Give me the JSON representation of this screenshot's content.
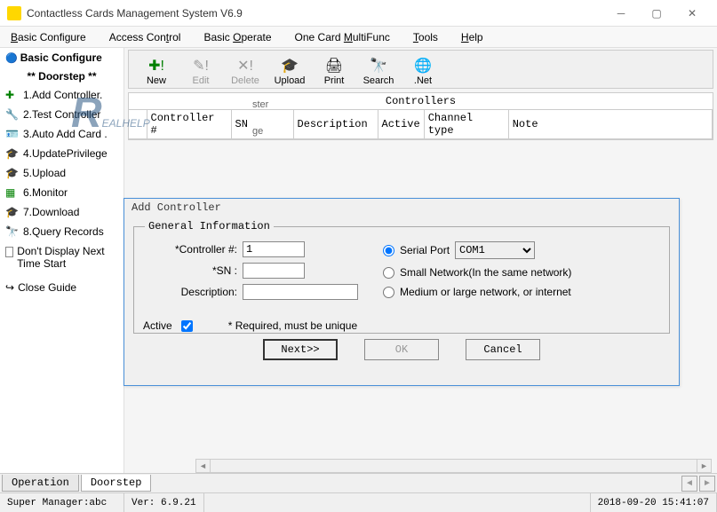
{
  "titlebar": {
    "title": "Contactless Cards Management System  V6.9"
  },
  "menubar": {
    "basic_configure": "Basic Configure",
    "access_control": "Access Control",
    "basic_operate": "Basic Operate",
    "one_card": "One Card MultiFunc",
    "tools": "Tools",
    "help": "Help"
  },
  "sidebar": {
    "header": "Basic Configure",
    "group": "** Doorstep **",
    "items": [
      "1.Add Controller.",
      "2.Test Controller",
      "3.Auto Add Card .",
      "4.UpdatePrivilege",
      "5.Upload",
      "6.Monitor",
      "7.Download",
      "8.Query Records"
    ],
    "dont_display": "Don't Display Next Time Start",
    "close_guide": "Close Guide"
  },
  "remnants": {
    "ster": "ster",
    "ge": "ge"
  },
  "logo": {
    "r": "R",
    "rest": "EALHELP"
  },
  "toolbar": {
    "new": "New",
    "edit": "Edit",
    "delete": "Delete",
    "upload": "Upload",
    "print": "Print",
    "search": "Search",
    "net": ".Net"
  },
  "table": {
    "caption": "Controllers",
    "cols": [
      "Controller #",
      "SN",
      "Description",
      "Active",
      "Channel type",
      "Note"
    ]
  },
  "dialog": {
    "title": "Add Controller",
    "legend": "General Information",
    "controller_no_lbl": "*Controller #:",
    "controller_no_val": "1",
    "sn_lbl": "*SN :",
    "sn_val": "",
    "desc_lbl": "Description:",
    "desc_val": "",
    "active_lbl": "Active",
    "required_note": "*  Required, must be unique",
    "serial_port_lbl": "Serial Port",
    "serial_port_val": "COM1",
    "small_net_lbl": "Small Network(In the same network)",
    "med_net_lbl": "Medium or large network, or internet",
    "next": "Next>>",
    "ok": "OK",
    "cancel": "Cancel"
  },
  "bottom_tabs": {
    "operation": "Operation",
    "doorstep": "Doorstep"
  },
  "statusbar": {
    "user": "Super Manager:abc",
    "ver": "Ver: 6.9.21",
    "datetime": "2018-09-20 15:41:07"
  }
}
